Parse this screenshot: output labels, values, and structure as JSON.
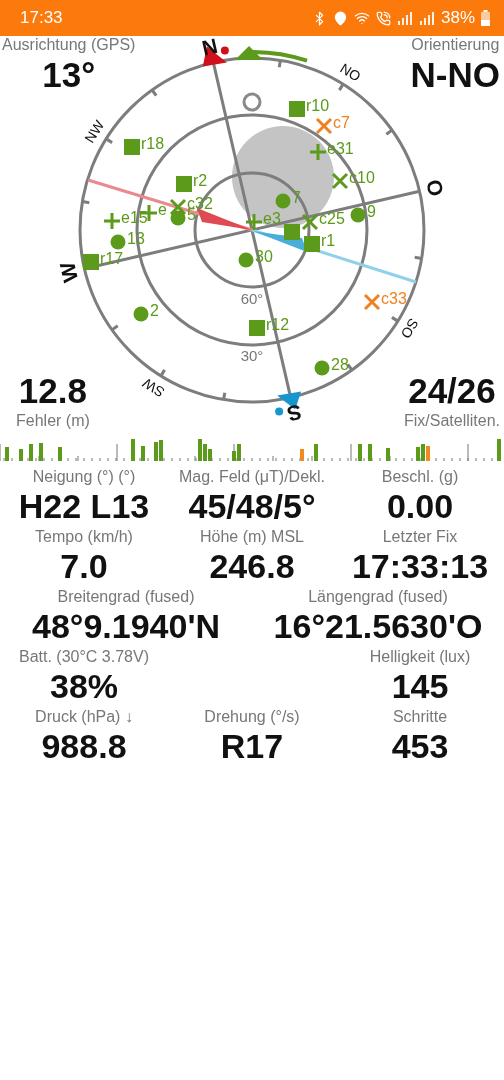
{
  "status_bar": {
    "time": "17:33",
    "battery": "38%"
  },
  "compass": {
    "heading_label": "Ausrichtung (GPS)",
    "heading": "13°",
    "orientation_label": "Orientierung",
    "orientation": "N-NO",
    "error": "12.8",
    "error_label": "Fehler (m)",
    "fix": "24/26",
    "fix_label": "Fix/Satelliten.",
    "directions": [
      "N",
      "NO",
      "O",
      "SO",
      "S",
      "SW",
      "W",
      "NW"
    ],
    "elevations": [
      "60°",
      "30°"
    ],
    "satellites": [
      {
        "kind": "ring",
        "color": "#8a8a8a"
      },
      {
        "kind": "square",
        "label": "r10",
        "color": "#5b9a1a"
      },
      {
        "kind": "cross",
        "label": "c7",
        "color": "#f08020"
      },
      {
        "kind": "plus",
        "label": "e31",
        "color": "#5b9a1a"
      },
      {
        "kind": "cross",
        "label": "c10",
        "color": "#5b9a1a"
      },
      {
        "kind": "square",
        "label": "r18",
        "color": "#5b9a1a"
      },
      {
        "kind": "square",
        "label": "r2",
        "color": "#5b9a1a"
      },
      {
        "kind": "cross",
        "label": "c32",
        "color": "#5b9a1a"
      },
      {
        "kind": "plus",
        "label": "e",
        "color": "#5b9a1a"
      },
      {
        "kind": "plus",
        "label": "e15",
        "color": "#5b9a1a"
      },
      {
        "kind": "circle",
        "label": "5",
        "color": "#5b9a1a"
      },
      {
        "kind": "circle",
        "label": "13",
        "color": "#5b9a1a"
      },
      {
        "kind": "square",
        "label": "r17",
        "color": "#5b9a1a"
      },
      {
        "kind": "circle",
        "label": "7",
        "color": "#5b9a1a"
      },
      {
        "kind": "circle",
        "label": "9",
        "color": "#5b9a1a"
      },
      {
        "kind": "plus",
        "label": "e3",
        "color": "#5b9a1a"
      },
      {
        "kind": "square",
        "color": "#5b9a1a"
      },
      {
        "kind": "cross",
        "label": "c25",
        "color": "#5b9a1a"
      },
      {
        "kind": "square",
        "label": "r1",
        "color": "#5b9a1a"
      },
      {
        "kind": "circle",
        "label": "30",
        "color": "#5b9a1a"
      },
      {
        "kind": "circle",
        "label": "2",
        "color": "#5b9a1a"
      },
      {
        "kind": "square",
        "label": "r12",
        "color": "#5b9a1a"
      },
      {
        "kind": "cross",
        "label": "c33",
        "color": "#f08020"
      },
      {
        "kind": "circle",
        "label": "28",
        "color": "#5b9a1a"
      }
    ]
  },
  "readings": [
    {
      "kind": "thirds",
      "items": [
        {
          "label": "Neigung (°) (°)",
          "value": "H22 L13"
        },
        {
          "label": "Mag. Feld (μT)/Dekl.",
          "value": "45/48/5°"
        },
        {
          "label": "Beschl. (g)",
          "value": "0.00"
        }
      ]
    },
    {
      "kind": "thirds",
      "items": [
        {
          "label": "Tempo (km/h)",
          "value": "7.0"
        },
        {
          "label": "Höhe (m) MSL",
          "value": "246.8"
        },
        {
          "label": "Letzter Fix",
          "value": "17:33:13"
        }
      ]
    },
    {
      "kind": "halves",
      "items": [
        {
          "label": "Breitengrad (fused)",
          "value": "48°9.1940'N"
        },
        {
          "label": "Längengrad (fused)",
          "value": "16°21.5630'O"
        }
      ]
    },
    {
      "kind": "thirds",
      "items": [
        {
          "label": "Batt. (30°C 3.78V)",
          "value": "38%"
        },
        {
          "label": "Helligkeit (lux)",
          "value": "145"
        }
      ]
    },
    {
      "kind": "thirds",
      "items": [
        {
          "label": "Druck (hPa) ↓",
          "value": "988.8"
        },
        {
          "label": "Drehung (°/s)",
          "value": "R17"
        },
        {
          "label": "Schritte",
          "value": "453"
        }
      ]
    }
  ]
}
